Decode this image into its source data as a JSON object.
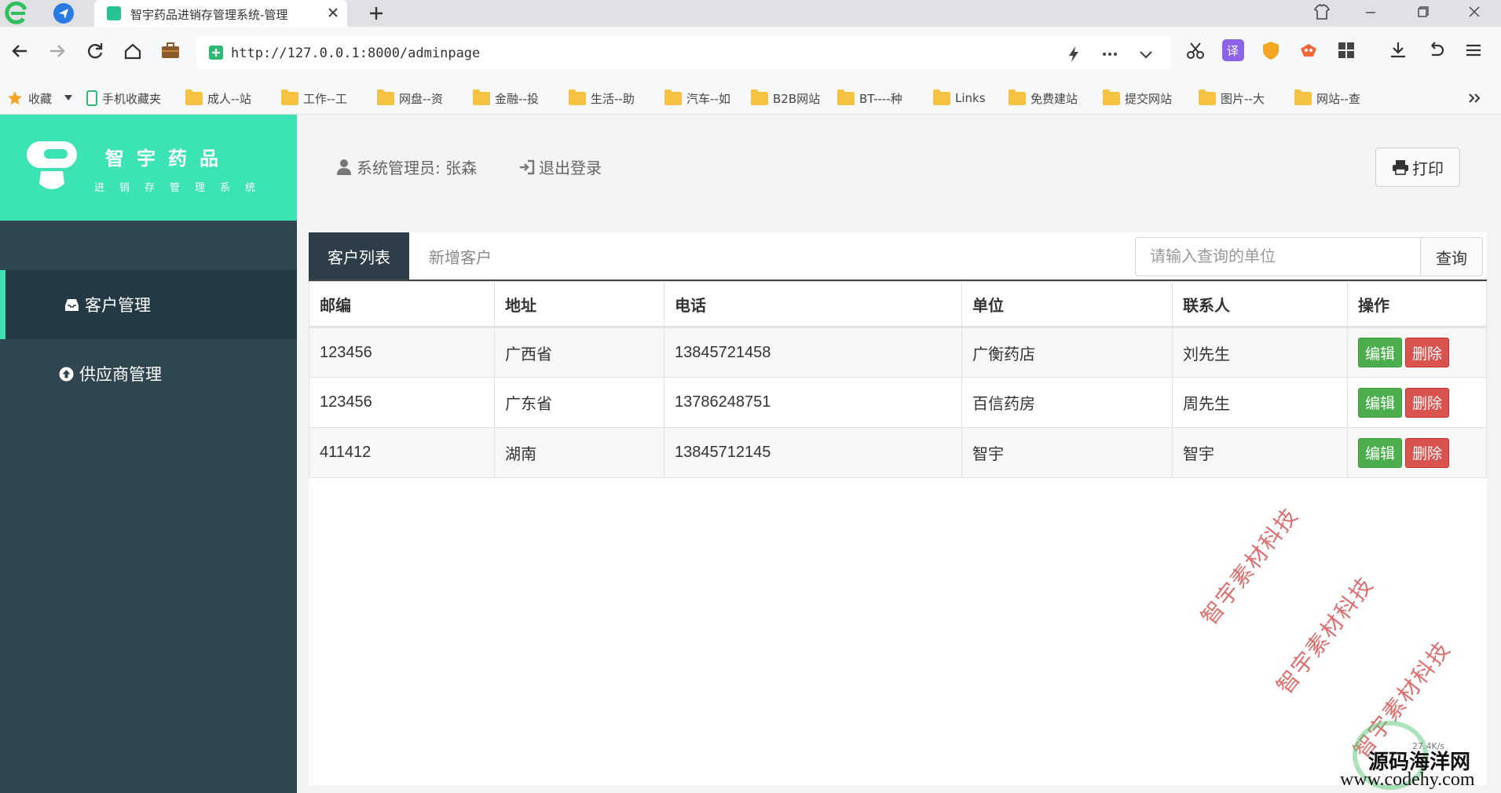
{
  "browser": {
    "tab_title": "智宇药品进销存管理系统-管理",
    "url": "http://127.0.0.1:8000/adminpage",
    "bookmarks": [
      "收藏",
      "手机收藏夹",
      "成人--站",
      "工作--工",
      "网盘--资",
      "金融--投",
      "生活--助",
      "汽车--如",
      "B2B网站",
      "BT----种",
      "Links",
      "免费建站",
      "提交网站",
      "图片--大",
      "网站--查"
    ],
    "icons": [
      "browser-logo-icon",
      "send-icon",
      "close-icon",
      "plus-icon",
      "shirt-icon",
      "minimize-icon",
      "maximize-icon",
      "back-icon",
      "forward-icon",
      "reload-icon",
      "home-icon",
      "briefcase-icon",
      "bolt-icon",
      "more-icon",
      "chevron-down-icon",
      "scissors-icon",
      "translate-icon",
      "shield-icon",
      "game-icon",
      "grid-icon",
      "download-icon",
      "undo-icon",
      "menu-icon",
      "star-icon",
      "phone-icon",
      "folder-icon",
      "chevrons-right-icon"
    ],
    "colors": {
      "secure": "#2eb872",
      "folder": "#f5c242"
    }
  },
  "app": {
    "logo": {
      "title": "智宇药品",
      "subtitle": "进销存管理系统"
    },
    "header": {
      "user_label": "系统管理员: 张森",
      "logout_label": "退出登录",
      "print_label": "打印"
    },
    "sidebar": {
      "items": [
        {
          "label": "客户管理",
          "icon": "inbox-icon",
          "active": true
        },
        {
          "label": "供应商管理",
          "icon": "arrow-circle-up-icon",
          "active": false
        }
      ]
    },
    "tabs": [
      {
        "label": "客户列表",
        "active": true
      },
      {
        "label": "新增客户",
        "active": false
      }
    ],
    "search": {
      "placeholder": "请输入查询的单位",
      "value": "",
      "button_label": "查询"
    },
    "table": {
      "columns": [
        "邮编",
        "地址",
        "电话",
        "单位",
        "联系人",
        "操作"
      ],
      "rows": [
        {
          "zip": "123456",
          "address": "广西省",
          "phone": "13845721458",
          "company": "广衡药店",
          "contact": "刘先生"
        },
        {
          "zip": "123456",
          "address": "广东省",
          "phone": "13786248751",
          "company": "百信药房",
          "contact": "周先生"
        },
        {
          "zip": "411412",
          "address": "湖南",
          "phone": "13845712145",
          "company": "智宇",
          "contact": "智宇"
        }
      ],
      "edit_label": "编辑",
      "delete_label": "删除"
    },
    "colors": {
      "accent": "#3be3b5",
      "sidebar": "#2f4650",
      "edit": "#4cad4d",
      "delete": "#d9534f"
    }
  },
  "overlay": {
    "watermarks": [
      "智宇素材科技",
      "智宇素材科技",
      "智宇素材科技"
    ],
    "site_name": "源码海洋网",
    "site_url": "www.codehy.com",
    "speed": "27.4K/s"
  }
}
